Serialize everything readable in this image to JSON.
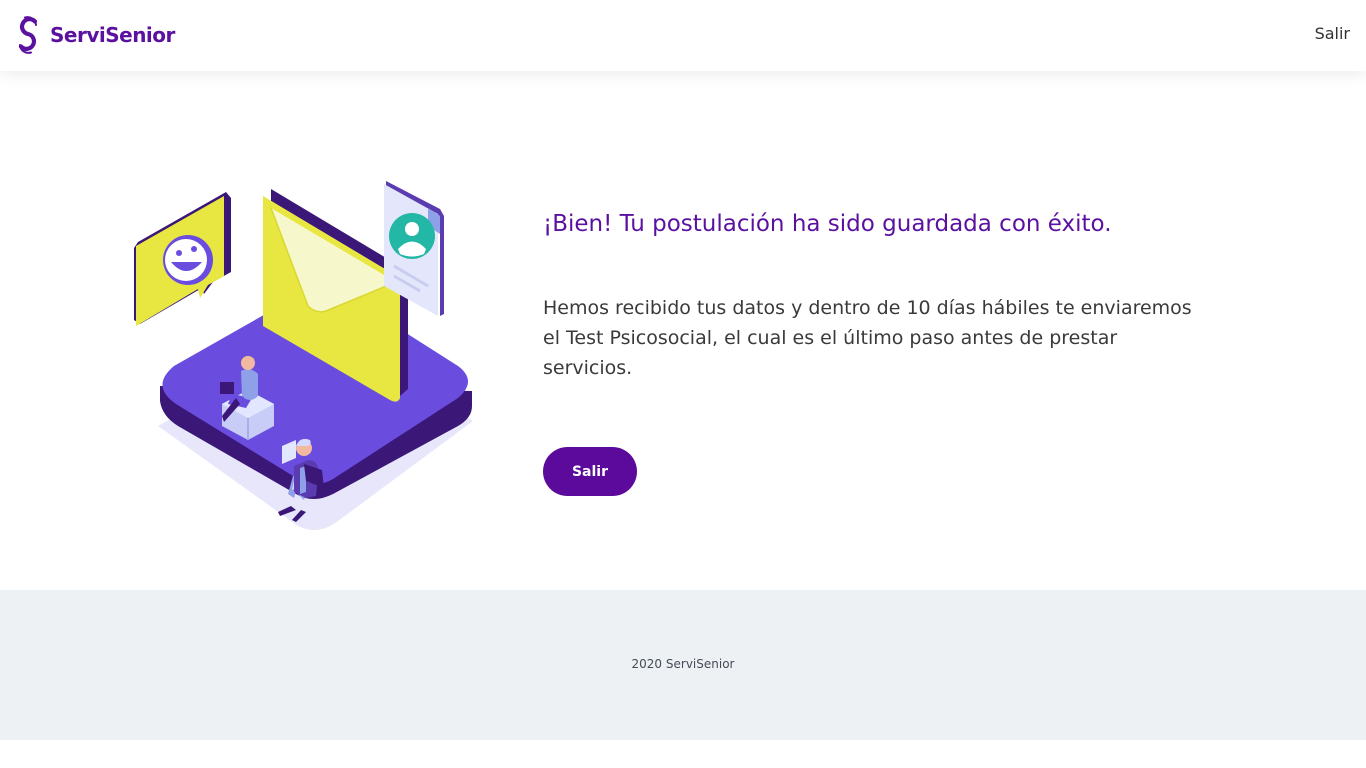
{
  "brand": {
    "name": "ServiSenior",
    "primary_color": "#5b11a0",
    "logo_icon": "servisenior-s-logo"
  },
  "header": {
    "exit_label": "Salir"
  },
  "main": {
    "title": "¡Bien! Tu postulación ha sido guardada con éxito.",
    "body": "Hemos recibido tus datos y dentro de 10 días hábiles te enviaremos el Test Psicosocial, el cual es el último paso antes de prestar servicios.",
    "exit_button_label": "Salir",
    "illustration": "isometric-envelope-illustration"
  },
  "footer": {
    "text": "2020 ServiSenior"
  }
}
